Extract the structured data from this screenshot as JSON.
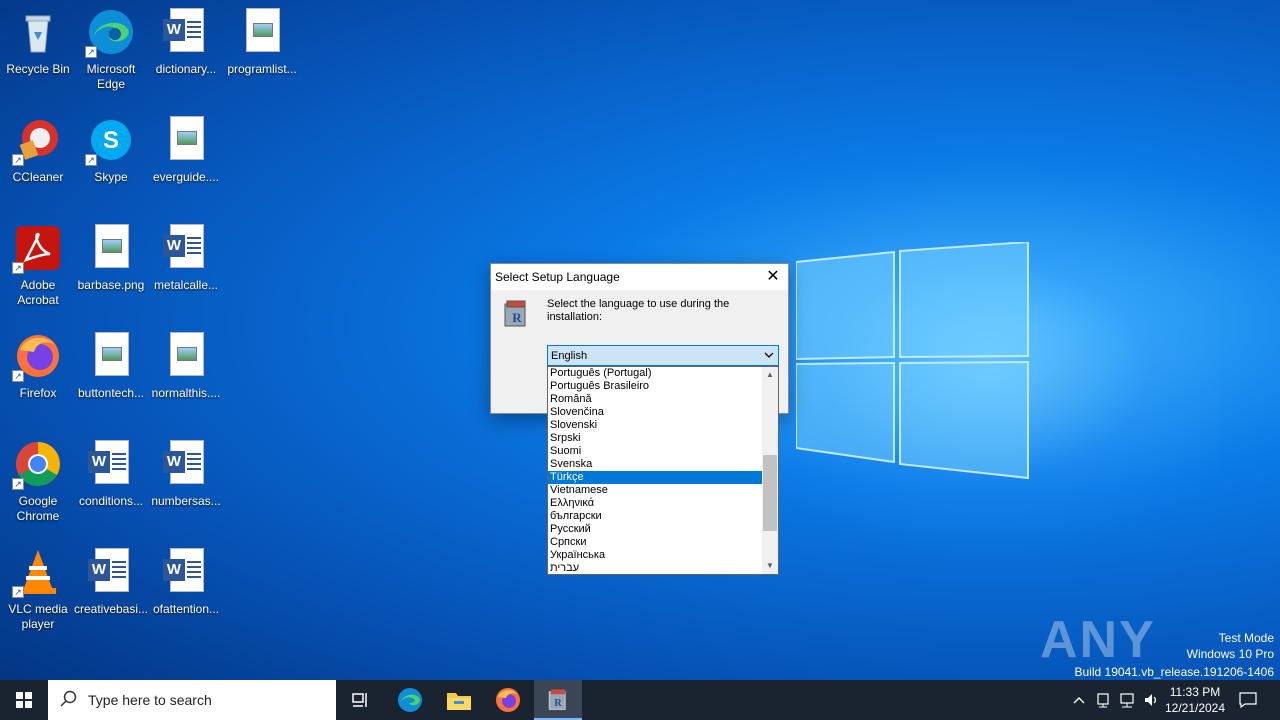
{
  "desktop": {
    "icons": [
      {
        "label": "Recycle Bin"
      },
      {
        "label": "Microsoft Edge"
      },
      {
        "label": "dictionary..."
      },
      {
        "label": "programlist..."
      },
      {
        "label": "CCleaner"
      },
      {
        "label": "Skype"
      },
      {
        "label": "everguide...."
      },
      {
        "label": "Adobe Acrobat"
      },
      {
        "label": "barbase.png"
      },
      {
        "label": "metalcalle..."
      },
      {
        "label": "Firefox"
      },
      {
        "label": "buttontech..."
      },
      {
        "label": "normalthis...."
      },
      {
        "label": "Google Chrome"
      },
      {
        "label": "conditions..."
      },
      {
        "label": "numbersas..."
      },
      {
        "label": "VLC media player"
      },
      {
        "label": "creativebasi..."
      },
      {
        "label": "ofattention..."
      }
    ]
  },
  "watermark": {
    "brand": "ANY RUN",
    "mode": "Test Mode",
    "os": "Windows 10 Pro",
    "build": "Build 19041.vb_release.191206-1406"
  },
  "dialog": {
    "title": "Select Setup Language",
    "close_glyph": "✕",
    "prompt": "Select the language to use during the installation:",
    "selected_value": "English",
    "options": [
      "Português (Portugal)",
      "Português Brasileiro",
      "Română",
      "Slovenčina",
      "Slovenski",
      "Srpski",
      "Suomi",
      "Svenska",
      "Türkçe",
      "Vietnamese",
      "Ελληνικά",
      "български",
      "Русский",
      "Српски",
      "Українська",
      "עברית"
    ],
    "highlighted_option": "Türkçe"
  },
  "taskbar": {
    "search_placeholder": "Type here to search",
    "time": "11:33 PM",
    "date": "12/21/2024"
  },
  "colors": {
    "accent": "#0078d7",
    "taskbar": "#1a2330"
  }
}
